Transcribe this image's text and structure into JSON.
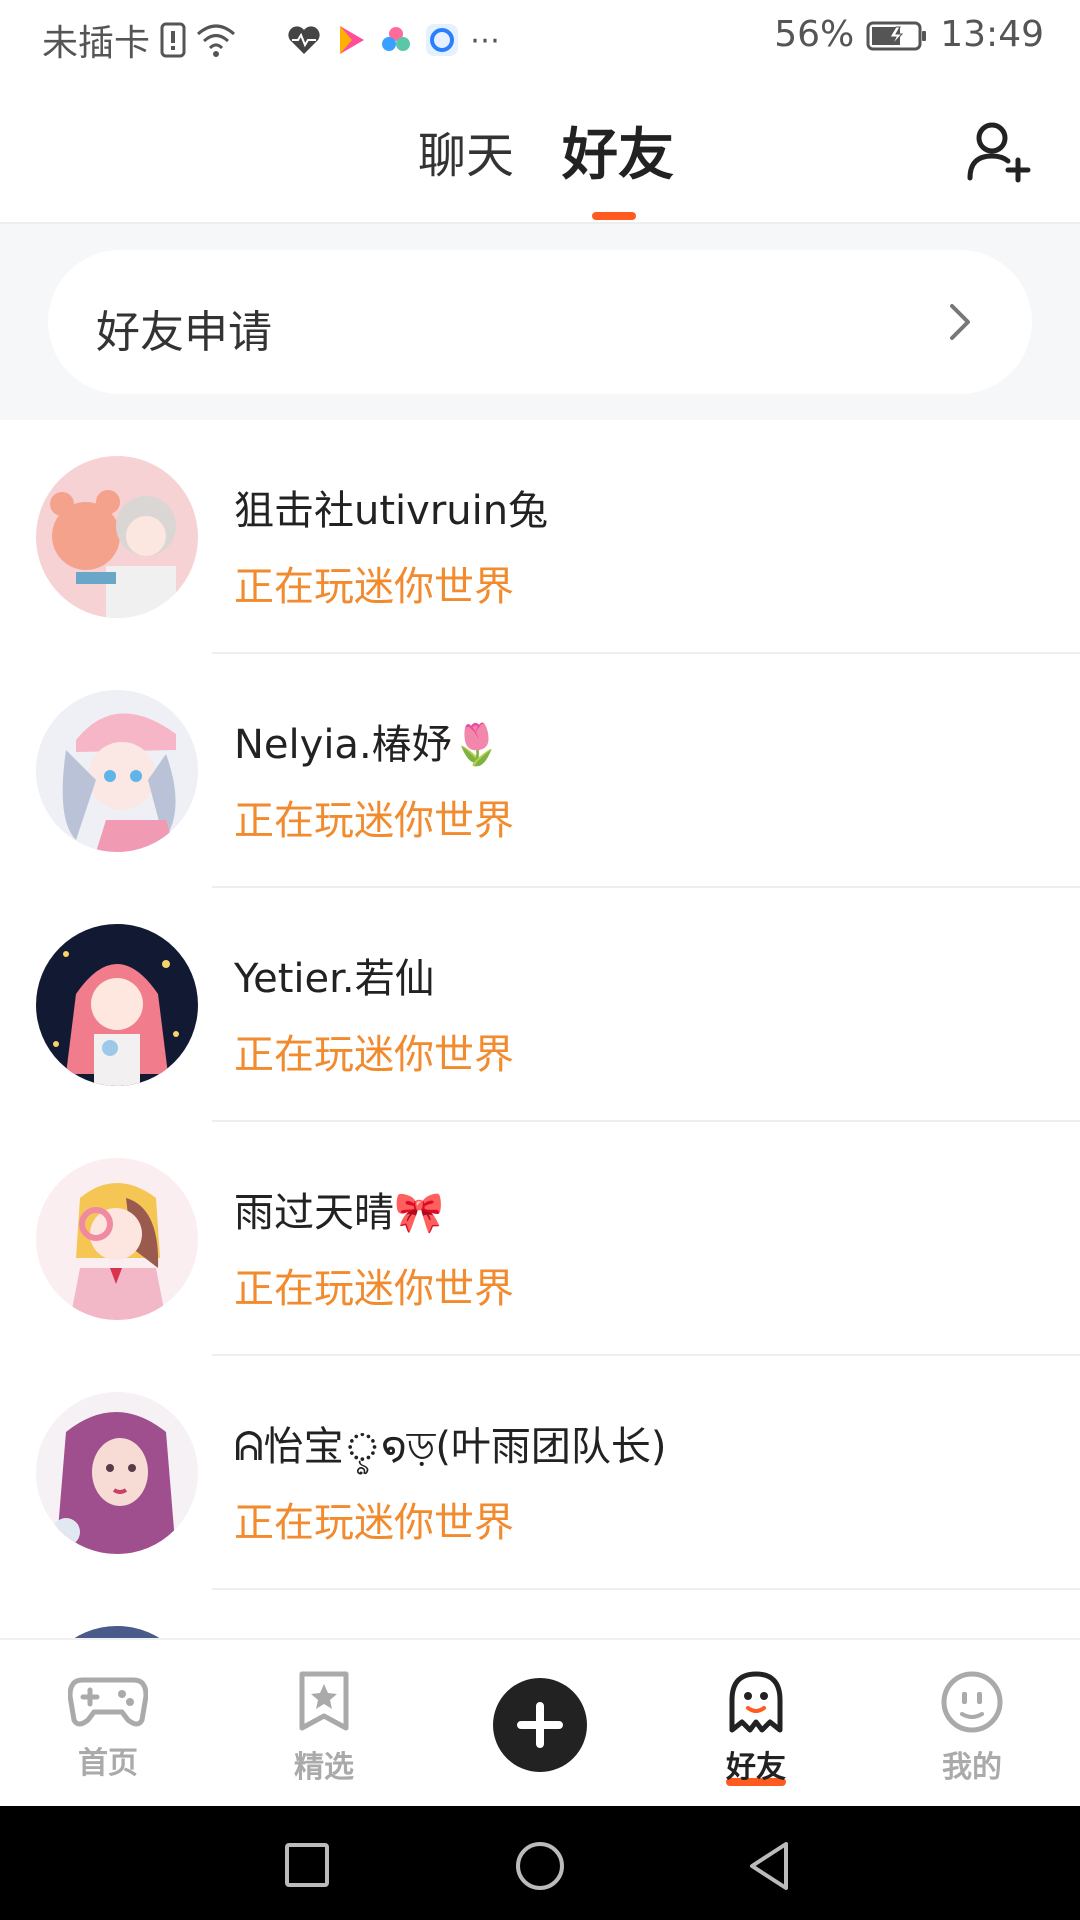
{
  "status_bar": {
    "carrier": "未插卡",
    "battery": "56%",
    "time": "13:49"
  },
  "header": {
    "tabs": [
      {
        "label": "聊天",
        "active": false
      },
      {
        "label": "好友",
        "active": true
      }
    ],
    "accent_color": "#ff5a1f"
  },
  "friend_request": {
    "label": "好友申请"
  },
  "friends": [
    {
      "name": "狙击社utivruin兔",
      "status": "正在玩迷你世界"
    },
    {
      "name": "Nelyia.椿妤🌷",
      "status": "正在玩迷你世界"
    },
    {
      "name": "Yetier.若仙",
      "status": "正在玩迷你世界"
    },
    {
      "name": "雨过天晴🎀",
      "status": "正在玩迷你世界"
    },
    {
      "name": "ᕱ怡宝ৢ໑ড়(叶雨团队长)",
      "status": "正在玩迷你世界"
    }
  ],
  "status_color": "#f28a2e",
  "bottom_nav": {
    "items": [
      {
        "label": "首页",
        "icon": "gamepad-icon",
        "active": false
      },
      {
        "label": "精选",
        "icon": "star-bookmark-icon",
        "active": false
      },
      {
        "label": "好友",
        "icon": "ghost-icon",
        "active": true
      },
      {
        "label": "我的",
        "icon": "smiley-icon",
        "active": false
      }
    ]
  }
}
